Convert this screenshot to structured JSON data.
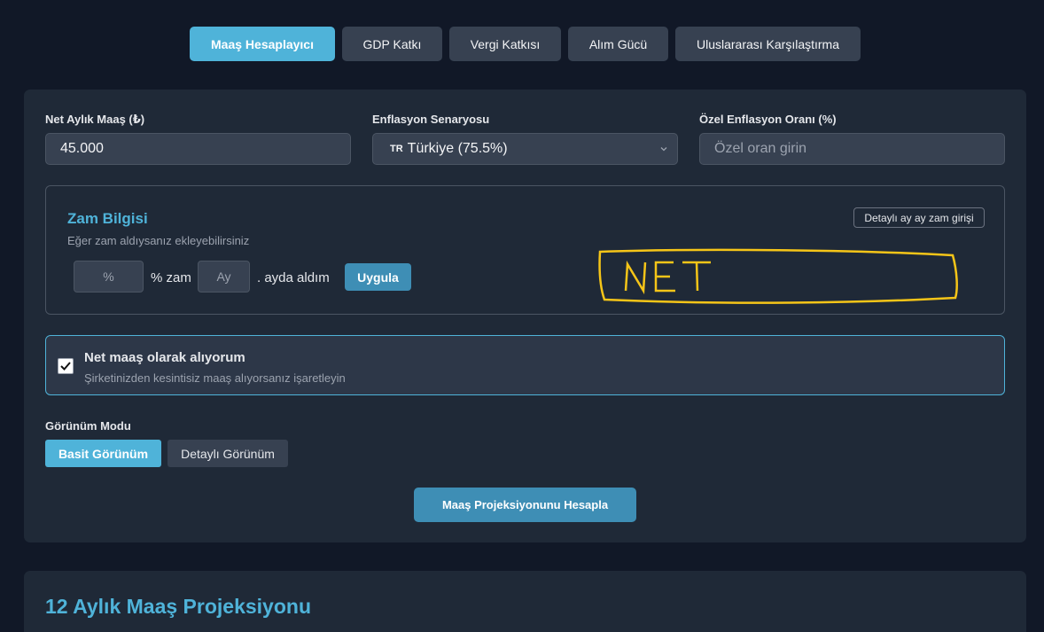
{
  "tabs": [
    {
      "label": "Maaş Hesaplayıcı",
      "active": true
    },
    {
      "label": "GDP Katkı",
      "active": false
    },
    {
      "label": "Vergi Katkısı",
      "active": false
    },
    {
      "label": "Alım Gücü",
      "active": false
    },
    {
      "label": "Uluslararası Karşılaştırma",
      "active": false
    }
  ],
  "form": {
    "net_salary_label": "Net Aylık Maaş (₺)",
    "net_salary_value": "45.000",
    "inflation_label": "Enflasyon Senaryosu",
    "inflation_flag": "TR",
    "inflation_value": "Türkiye (75.5%)",
    "custom_rate_label": "Özel Enflasyon Oranı (%)",
    "custom_rate_placeholder": "Özel oran girin"
  },
  "raise": {
    "title": "Zam Bilgisi",
    "subtitle": "Eğer zam aldıysanız ekleyebilirsiniz",
    "detail_button": "Detaylı ay ay zam girişi",
    "percent_placeholder": "%",
    "percent_suffix": "% zam",
    "month_placeholder": "Ay",
    "month_suffix": ". ayda aldım",
    "apply_button": "Uygula"
  },
  "annotation": {
    "text": "NET",
    "color": "#f5c518"
  },
  "net_option": {
    "checked": true,
    "title": "Net maaş olarak alıyorum",
    "subtitle": "Şirketinizden kesintisiz maaş alıyorsanız işaretleyin"
  },
  "view_mode": {
    "label": "Görünüm Modu",
    "options": [
      {
        "label": "Basit Görünüm",
        "active": true
      },
      {
        "label": "Detaylı Görünüm",
        "active": false
      }
    ]
  },
  "calculate_button": "Maaş Projeksiyonunu Hesapla",
  "projection": {
    "title": "12 Aylık Maaş Projeksiyonu"
  },
  "colors": {
    "accent": "#4fb3d9",
    "background": "#111827",
    "card": "#1f2937"
  }
}
